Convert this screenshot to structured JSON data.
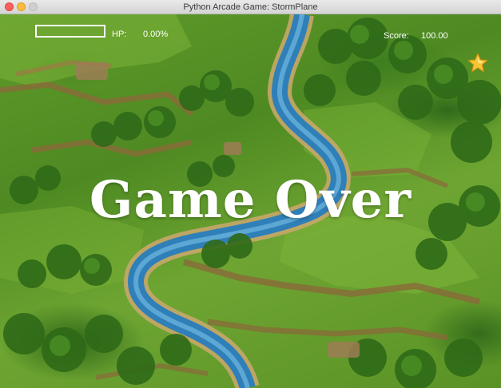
{
  "window": {
    "title": "Python Arcade Game: StormPlane"
  },
  "hud": {
    "hp_label": "HP:",
    "hp_value": "0.00%",
    "hp_fraction": 0.0,
    "score_label": "Score:",
    "score_value": "100.00"
  },
  "powerup": {
    "icon": "star-icon",
    "color": "#f7c531"
  },
  "overlay": {
    "message": "Game Over"
  },
  "colors": {
    "hp_border": "#ffffff",
    "hp_fill": "#e63b2e",
    "river": "#2f7fb8",
    "grass": "#5f9a2a"
  }
}
